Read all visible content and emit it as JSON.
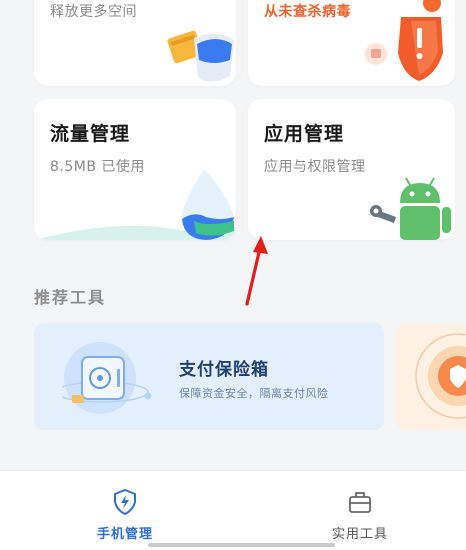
{
  "cards": {
    "space": {
      "subtitle": "释放更多空间"
    },
    "virus": {
      "subtitle": "从未查杀病毒"
    },
    "traffic": {
      "title": "流量管理",
      "subtitle": "8.5MB 已使用"
    },
    "apps": {
      "title": "应用管理",
      "subtitle": "应用与权限管理"
    }
  },
  "recommended": {
    "section_title": "推荐工具",
    "tools": [
      {
        "title": "支付保险箱",
        "subtitle": "保障资金安全，隔离支付风险"
      }
    ]
  },
  "tabbar": {
    "tabs": [
      {
        "label": "手机管理",
        "icon": "lightning-shield-icon",
        "active": true
      },
      {
        "label": "实用工具",
        "icon": "toolbox-icon",
        "active": false
      }
    ]
  },
  "colors": {
    "accent_blue": "#2f6fd6",
    "warning_orange": "#f0612d",
    "annotation_red": "#e0201b"
  }
}
